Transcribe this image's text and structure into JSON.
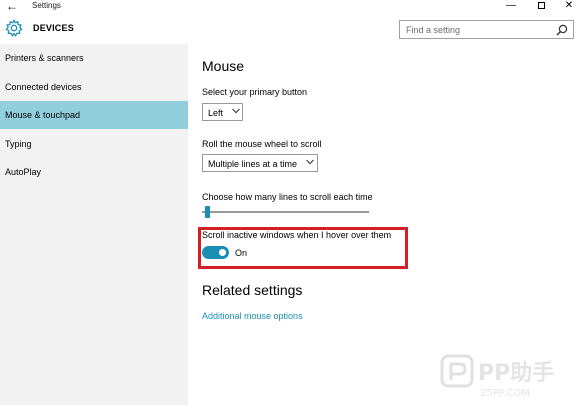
{
  "window": {
    "title": "Settings",
    "back_glyph": "←",
    "minimize_glyph": "—",
    "close_glyph": "✕"
  },
  "header": {
    "icon": "gear-icon",
    "title": "DEVICES",
    "search_placeholder": "Find a setting"
  },
  "sidebar": {
    "items": [
      {
        "label": "Printers & scanners",
        "active": false
      },
      {
        "label": "Connected devices",
        "active": false
      },
      {
        "label": "Mouse & touchpad",
        "active": true
      },
      {
        "label": "Typing",
        "active": false
      },
      {
        "label": "AutoPlay",
        "active": false
      }
    ]
  },
  "main": {
    "heading": "Mouse",
    "primary_button": {
      "label": "Select your primary button",
      "value": "Left"
    },
    "scroll_wheel": {
      "label": "Roll the mouse wheel to scroll",
      "value": "Multiple lines at a time"
    },
    "lines_to_scroll": {
      "label": "Choose how many lines to scroll each time",
      "value_fraction": 0.03
    },
    "scroll_inactive": {
      "label": "Scroll inactive windows when I hover over them",
      "state": "On"
    },
    "related_heading": "Related settings",
    "related_link": "Additional mouse options"
  },
  "watermark": {
    "logo_text": "PP助手",
    "subtext": "25PP.COM"
  },
  "colors": {
    "accent": "#1a8fb5",
    "sidebar_active": "#92cfdd",
    "sidebar_bg": "#f2f2f2",
    "highlight_border": "#d61e27"
  }
}
